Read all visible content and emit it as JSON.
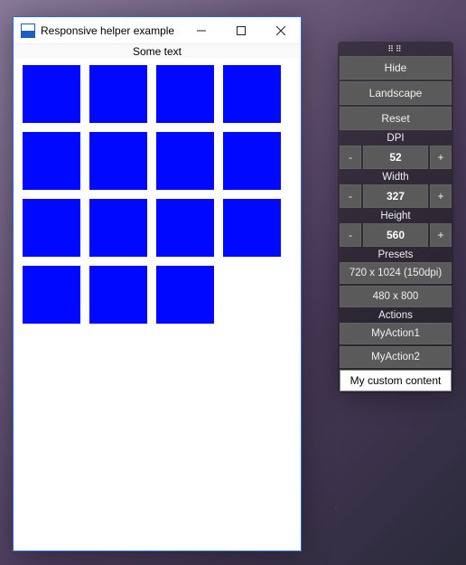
{
  "window": {
    "title": "Responsive helper example",
    "header_text": "Some text",
    "grid_count": 15
  },
  "panel": {
    "hide": "Hide",
    "landscape": "Landscape",
    "reset": "Reset",
    "dpi_label": "DPI",
    "dpi_value": "52",
    "width_label": "Width",
    "width_value": "327",
    "height_label": "Height",
    "height_value": "560",
    "minus": "-",
    "plus": "+",
    "presets_label": "Presets",
    "presets": [
      "720 x 1024 (150dpi)",
      "480 x 800"
    ],
    "actions_label": "Actions",
    "actions": [
      "MyAction1",
      "MyAction2"
    ],
    "custom": "My custom content"
  }
}
